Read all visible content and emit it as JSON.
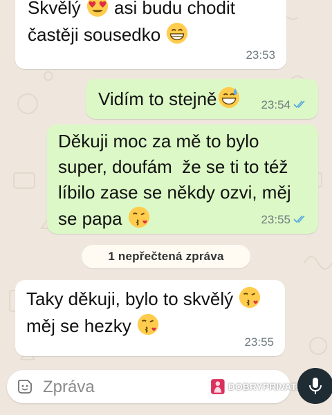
{
  "colors": {
    "chat_background": "#efe7de",
    "incoming_bubble": "#ffffff",
    "outgoing_bubble": "#dcf8c6",
    "read_ticks": "#4fa3e0",
    "mic_button": "#1f2c34",
    "watermark_accent": "#d9305c"
  },
  "messages": [
    {
      "direction": "incoming",
      "parts": [
        "Skvělý",
        "asi budu chodit\nčastěji sousedko"
      ],
      "emojis": [
        "heart-eyes-face",
        "grinning-face"
      ],
      "time": "23:53"
    },
    {
      "direction": "outgoing",
      "parts": [
        "Vidím to stejně"
      ],
      "emojis": [
        "grinning-sweat-face"
      ],
      "time": "23:54",
      "status": "read"
    },
    {
      "direction": "outgoing",
      "parts": [
        "Děkuji moc za mě to bylo\nsuper, doufám  že se ti to též\nlíbilo zase se někdy ozvi, měj\nse papa"
      ],
      "emojis": [
        "kissing-heart-face"
      ],
      "time": "23:55",
      "status": "read"
    },
    {
      "direction": "incoming",
      "parts": [
        "Taky děkuji, bylo to skvělý",
        "\nměj se hezky"
      ],
      "emojis": [
        "kissing-heart-face",
        "kissing-heart-face"
      ],
      "time": "23:55"
    }
  ],
  "unread_divider": "1 nepřečtená zpráva",
  "composer": {
    "placeholder": "Zpráva",
    "sticker_icon": "sticker-icon",
    "send_icon": "mic-icon"
  },
  "watermark": {
    "text": "DOBRYPRIVAT.CZ"
  }
}
